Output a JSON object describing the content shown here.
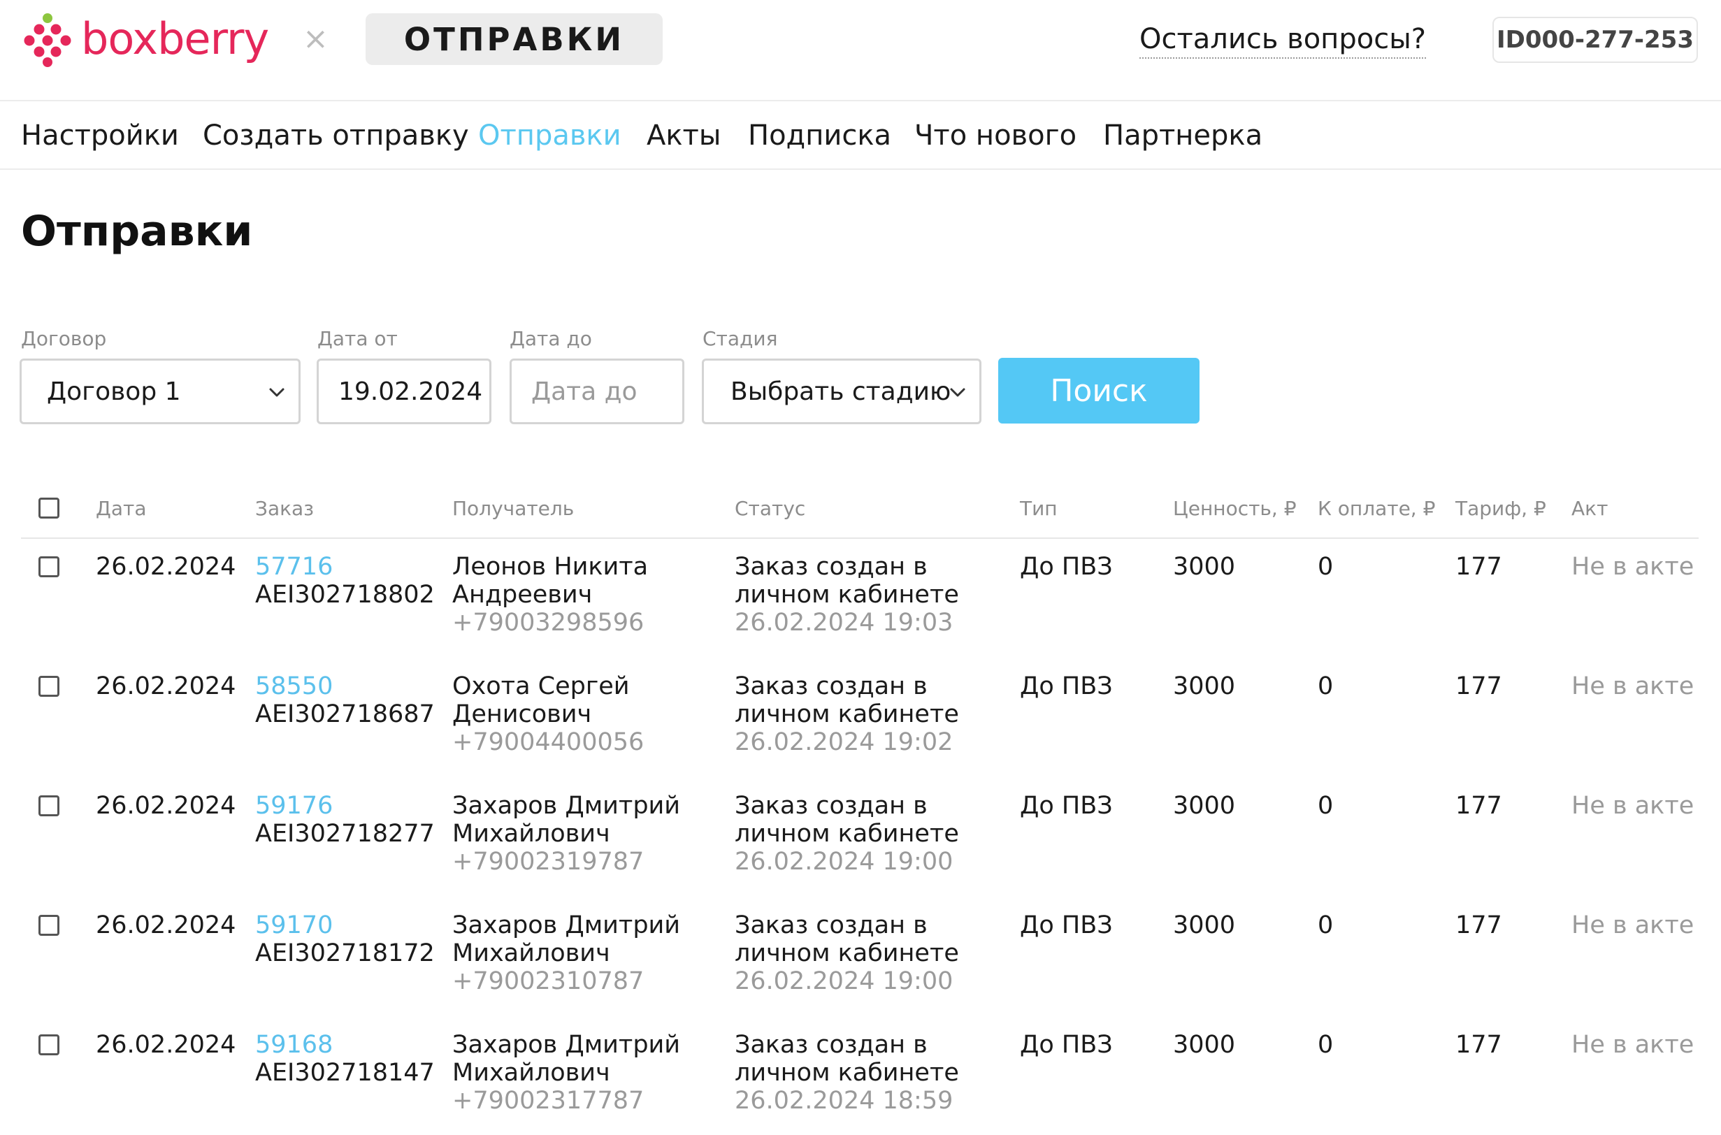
{
  "header": {
    "brand_name": "boxberry",
    "separator": "×",
    "product_name": "ОТПРАВКИ",
    "questions_link": "Остались вопросы?",
    "account_id": "ID000-277-253"
  },
  "nav": {
    "items": [
      {
        "label": "Настройки",
        "active": false
      },
      {
        "label": "Создать отправку",
        "active": false
      },
      {
        "label": "Отправки",
        "active": true
      },
      {
        "label": "Акты",
        "active": false
      },
      {
        "label": "Подписка",
        "active": false
      },
      {
        "label": "Что нового",
        "active": false
      },
      {
        "label": "Партнерка",
        "active": false
      }
    ]
  },
  "page": {
    "title": "Отправки"
  },
  "filters": {
    "contract": {
      "label": "Договор",
      "value": "Договор 1"
    },
    "date_from": {
      "label": "Дата от",
      "value": "19.02.2024"
    },
    "date_to": {
      "label": "Дата до",
      "placeholder": "Дата до"
    },
    "stage": {
      "label": "Стадия",
      "value": "Выбрать стадию"
    },
    "search_button": "Поиск"
  },
  "table": {
    "headers": {
      "date": "Дата",
      "order": "Заказ",
      "recipient": "Получатель",
      "status": "Статус",
      "type": "Тип",
      "value": "Ценность, ₽",
      "to_pay": "К оплате, ₽",
      "tariff": "Тариф, ₽",
      "act": "Акт"
    },
    "rows": [
      {
        "date": "26.02.2024",
        "order_id": "57716",
        "tracking": "AEI302718802",
        "name_line1": "Леонов Никита",
        "name_line2": "Андреевич",
        "phone": "+79003298596",
        "status_line1": "Заказ создан в",
        "status_line2": "личном кабинете",
        "status_time": "26.02.2024 19:03",
        "type": "До ПВЗ",
        "value": "3000",
        "to_pay": "0",
        "tariff": "177",
        "act": "Не в акте"
      },
      {
        "date": "26.02.2024",
        "order_id": "58550",
        "tracking": "AEI302718687",
        "name_line1": "Охота Сергей",
        "name_line2": "Денисович",
        "phone": "+79004400056",
        "status_line1": "Заказ создан в",
        "status_line2": "личном кабинете",
        "status_time": "26.02.2024 19:02",
        "type": "До ПВЗ",
        "value": "3000",
        "to_pay": "0",
        "tariff": "177",
        "act": "Не в акте"
      },
      {
        "date": "26.02.2024",
        "order_id": "59176",
        "tracking": "AEI302718277",
        "name_line1": "Захаров Дмитрий",
        "name_line2": "Михайлович",
        "phone": "+79002319787",
        "status_line1": "Заказ создан в",
        "status_line2": "личном кабинете",
        "status_time": "26.02.2024 19:00",
        "type": "До ПВЗ",
        "value": "3000",
        "to_pay": "0",
        "tariff": "177",
        "act": "Не в акте"
      },
      {
        "date": "26.02.2024",
        "order_id": "59170",
        "tracking": "AEI302718172",
        "name_line1": "Захаров Дмитрий",
        "name_line2": "Михайлович",
        "phone": "+79002310787",
        "status_line1": "Заказ создан в",
        "status_line2": "личном кабинете",
        "status_time": "26.02.2024 19:00",
        "type": "До ПВЗ",
        "value": "3000",
        "to_pay": "0",
        "tariff": "177",
        "act": "Не в акте"
      },
      {
        "date": "26.02.2024",
        "order_id": "59168",
        "tracking": "AEI302718147",
        "name_line1": "Захаров Дмитрий",
        "name_line2": "Михайлович",
        "phone": "+79002317787",
        "status_line1": "Заказ создан в",
        "status_line2": "личном кабинете",
        "status_time": "26.02.2024 18:59",
        "type": "До ПВЗ",
        "value": "3000",
        "to_pay": "0",
        "tariff": "177",
        "act": "Не в акте"
      }
    ]
  },
  "colors": {
    "brand": "#e5275a",
    "accent": "#5bc8f0",
    "button": "#54c8f5",
    "muted_text": "#9a9a9a"
  },
  "icons": {
    "brand_logo": "berry-dots-icon",
    "dropdown": "chevron-down-icon",
    "checkbox": "checkbox-icon"
  }
}
